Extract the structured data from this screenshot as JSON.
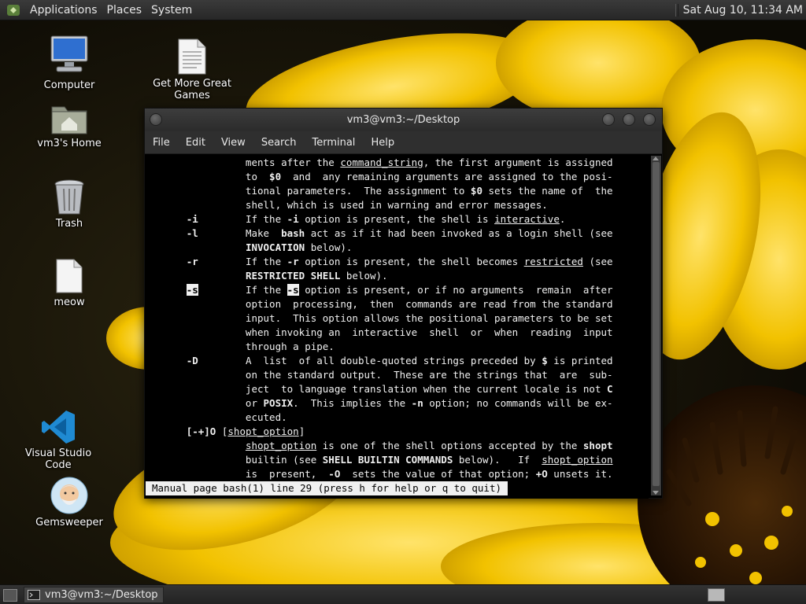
{
  "top_panel": {
    "menus": [
      "Applications",
      "Places",
      "System"
    ],
    "clock": "Sat Aug 10, 11:34 AM"
  },
  "desktop_icons": {
    "computer": "Computer",
    "home": "vm3's Home",
    "trash": "Trash",
    "meow": "meow",
    "games": "Get More Great Games",
    "vscode": "Visual Studio Code",
    "gemsweeper": "Gemsweeper"
  },
  "terminal": {
    "title": "vm3@vm3:~/Desktop",
    "menu": [
      "File",
      "Edit",
      "View",
      "Search",
      "Terminal",
      "Help"
    ],
    "status": "Manual page bash(1) line 29 (press h for help or q to quit)"
  },
  "taskbar": {
    "window_label": "vm3@vm3:~/Desktop"
  },
  "colors": {
    "panel": "#2b2b2b",
    "terminal_bg": "#000000",
    "terminal_fg": "#f0f0f0"
  }
}
